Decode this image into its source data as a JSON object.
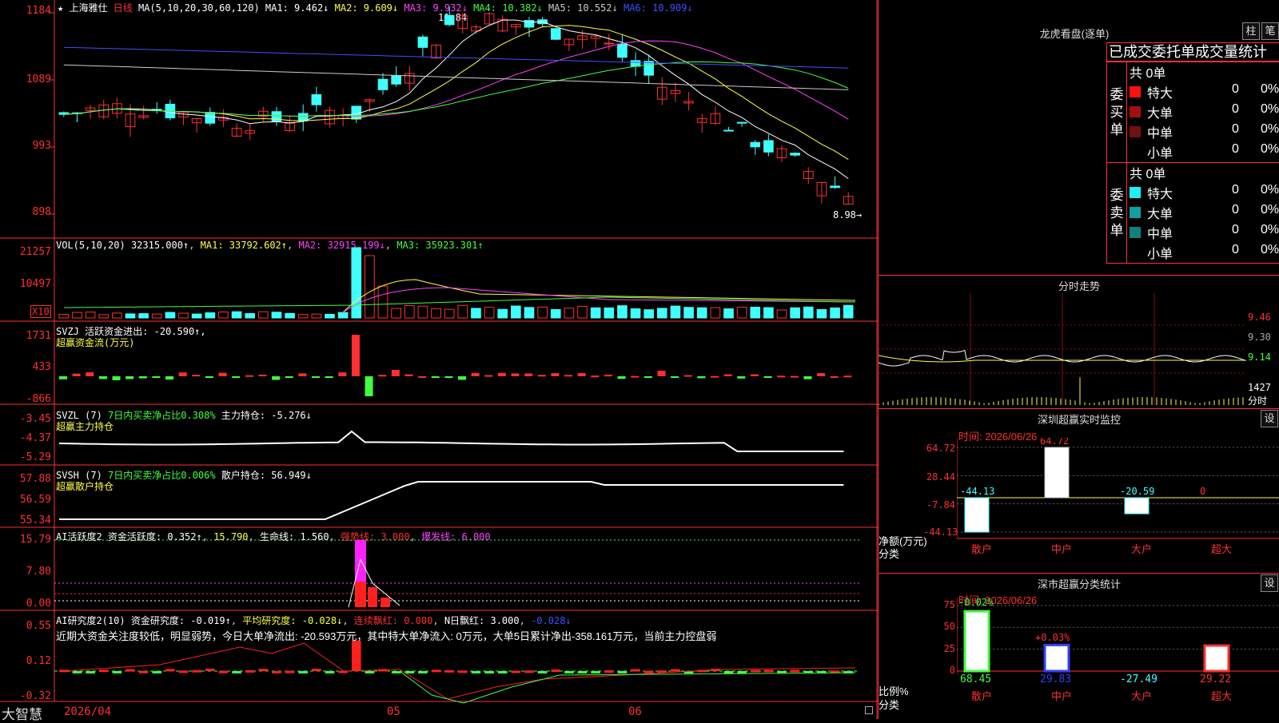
{
  "stock": {
    "name": "上海雅仕",
    "period": "日线",
    "ma_header": "MA(5,10,20,30,60,120)",
    "ma": [
      {
        "label": "MA1: 9.462↓",
        "color": "#ffffff"
      },
      {
        "label": "MA2: 9.609↓",
        "color": "#ffff40"
      },
      {
        "label": "MA3: 9.932↓",
        "color": "#ff40ff"
      },
      {
        "label": "MA4: 10.382↓",
        "color": "#40ff40"
      },
      {
        "label": "MA5: 10.552↓",
        "color": "#cccccc"
      },
      {
        "label": "MA6: 10.909↓",
        "color": "#4050ff"
      }
    ],
    "price_axis": [
      "1184",
      "1089",
      "993",
      "898"
    ],
    "high_label": "11.84",
    "last_label": "8.98→"
  },
  "vol_pane": {
    "title": "VOL(5,10,20)",
    "values": [
      {
        "t": "32315.000↑",
        "c": "#ffffff"
      },
      {
        "t": "MA1: 33792.602↑",
        "c": "#ffff40"
      },
      {
        "t": "MA2: 32915.199↓",
        "c": "#ff40ff"
      },
      {
        "t": "MA3: 35923.301↑",
        "c": "#40ff40"
      }
    ],
    "axis": [
      "21257",
      "10497"
    ],
    "unit": "X10"
  },
  "svzj_pane": {
    "title": "SVZJ",
    "line1": "活跃资金进出: -20.590↑,",
    "line2": "超赢资金流(万元)",
    "axis": [
      "1731",
      "433",
      "-866"
    ]
  },
  "svzl_pane": {
    "title": "SVZL (7)",
    "ratio": "7日内买卖净占比0.308%",
    "hold": "主力持仓: -5.276↓",
    "line2": "超赢主力持仓",
    "axis": [
      "-3.45",
      "-4.37",
      "-5.29"
    ]
  },
  "svsh_pane": {
    "title": "SVSH (7)",
    "ratio": "7日内买卖净占比0.006%",
    "hold": "散户持仓: 56.949↓",
    "line2": "超赢散户持仓",
    "axis": [
      "57.88",
      "56.59",
      "55.34"
    ]
  },
  "ai_active": {
    "title": "AI活跃度2",
    "v1": "资金活跃度: 0.352↑",
    "v2": "15.790",
    "v3": "生命线: 1.560",
    "v4": "强势线: 3.000",
    "v5": "爆发线: 6.000",
    "axis": [
      "15.79",
      "7.80",
      "0.00"
    ]
  },
  "ai_research": {
    "title": "AI研究度2(10)",
    "v1": "资金研究度: -0.019↑",
    "v2": "平均研究度: -0.028↓",
    "v3": "连续飘红: 0.000",
    "v4": "N日飘红: 3.000",
    "v5": "-0.028↓",
    "comment": "近期大资金关注度较低，明显弱势，今日大单净流出: -20.593万元，其中特大单净流入: 0万元，大单5日累计净出-358.161万元，当前主力控盘弱",
    "axis": [
      "0.55",
      "0.12",
      "-0.32"
    ]
  },
  "bottom_bar": {
    "brand": "大智慧",
    "date": "2026/04",
    "m1": "05",
    "m2": "06"
  },
  "dragon": {
    "title": "龙虎看盘(逐单)",
    "btn1": "柱",
    "btn2": "笔",
    "header": "已成交委托单成交量统计",
    "buy_label": "委买单",
    "sell_label": "委卖单",
    "buy_total": "共 0单",
    "sell_total": "共 0单",
    "buy_rows": [
      {
        "name": "特大",
        "count": "0",
        "pct": "0%",
        "color": "#ff1010"
      },
      {
        "name": "大单",
        "count": "0",
        "pct": "0%",
        "color": "#a01010"
      },
      {
        "name": "中单",
        "count": "0",
        "pct": "0%",
        "color": "#701010"
      },
      {
        "name": "小单",
        "count": "0",
        "pct": "0%",
        "color": "#000000"
      }
    ],
    "sell_rows": [
      {
        "name": "特大",
        "count": "0",
        "pct": "0%",
        "color": "#20f0f0"
      },
      {
        "name": "大单",
        "count": "0",
        "pct": "0%",
        "color": "#10a0a0"
      },
      {
        "name": "中单",
        "count": "0",
        "pct": "0%",
        "color": "#108080"
      },
      {
        "name": "小单",
        "count": "0",
        "pct": "0%",
        "color": "#000000"
      }
    ]
  },
  "intraday": {
    "title": "分时走势",
    "axis": [
      "9.46",
      "9.30",
      "9.14",
      "1427",
      "分时"
    ]
  },
  "monitor": {
    "title": "深圳超赢实时监控",
    "btn": "设",
    "time": "时间: 2026/06/26",
    "axis": [
      "64.72",
      "28.44",
      "-7.84",
      "-44.13"
    ],
    "ylabel": "净额(万元)",
    "xlabel": "分类",
    "categories": [
      "散户",
      "中户",
      "大户",
      "超大"
    ],
    "value_labels": [
      "-44.13",
      "64.72",
      "-20.59",
      "0"
    ]
  },
  "classify": {
    "title": "深市超赢分类统计",
    "btn": "设",
    "time": "时间: 2026/06/26",
    "axis": [
      "75",
      "50",
      "25",
      "0"
    ],
    "ylabel": "比例%",
    "xlabel": "分类",
    "categories": [
      "散户",
      "中户",
      "大户",
      "超大"
    ],
    "top_labels": [
      "-0.02%",
      "+0.03%"
    ],
    "bottom_values": [
      "68.45",
      "29.83",
      "-27.49",
      "29.22"
    ]
  },
  "chart_data": [
    {
      "type": "bar",
      "title": "深圳超赢实时监控",
      "categories": [
        "散户",
        "中户",
        "大户",
        "超大"
      ],
      "values": [
        -44.13,
        64.72,
        -20.59,
        0
      ],
      "ylabel": "净额(万元)",
      "xlabel": "分类",
      "ylim": [
        -44.13,
        64.72
      ]
    },
    {
      "type": "bar",
      "title": "深市超赢分类统计",
      "categories": [
        "散户",
        "中户",
        "大户",
        "超大"
      ],
      "values": [
        68.45,
        29.83,
        27.49,
        29.22
      ],
      "ylabel": "比例%",
      "xlabel": "分类",
      "ylim": [
        0,
        75
      ]
    }
  ]
}
